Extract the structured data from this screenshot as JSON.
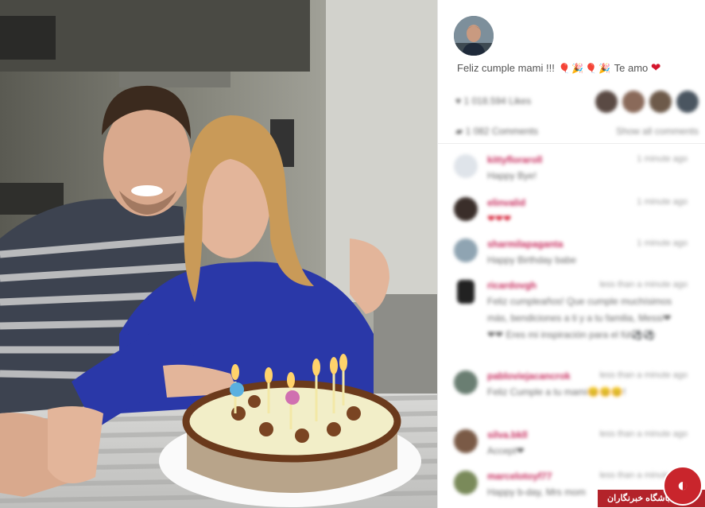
{
  "post": {
    "caption_text": "Feliz cumple mami !!!",
    "caption_emojis": [
      "🎈",
      "🎉",
      "🎈",
      "🎉"
    ],
    "caption_tail": "Te amo",
    "heart_icon": "heart-icon"
  },
  "stats": {
    "likes_text": "1 018.594 Likes",
    "comments_text": "1 082 Comments",
    "show_all_label": "Show all comments"
  },
  "comments": [
    {
      "user": "kittyfloraroll",
      "time": "1 minute ago",
      "text": "Happy Bye!"
    },
    {
      "user": "elinvalid",
      "time": "1 minute ago",
      "text": "❤❤❤"
    },
    {
      "user": "sharmilapaganta",
      "time": "1 minute ago",
      "text": "Happy Birthday babe"
    },
    {
      "user": "ricardovgh",
      "time": "less than a minute ago",
      "text": "Feliz cumpleaños! Que cumple muchísimos más, bendiciones a ti y a tu familia, Messi❤❤❤ Eres mi inspiración para el fút⚽⚽"
    },
    {
      "user": "pabloviejacancrok",
      "time": "less than a minute ago",
      "text": "Feliz Cumple a tu mami😊😊😊!"
    },
    {
      "user": "silva.bkll",
      "time": "less than a minute ago",
      "text": "Accept❤"
    },
    {
      "user": "marcelotoyf77",
      "time": "less than a minute ago",
      "text": "Happy b-day, Mrs mom"
    }
  ],
  "watermark": {
    "label": "باشگاه خبرنگاران"
  },
  "colors": {
    "accent": "#c6285a",
    "heart": "#d4162d",
    "badge": "#b3232a"
  }
}
